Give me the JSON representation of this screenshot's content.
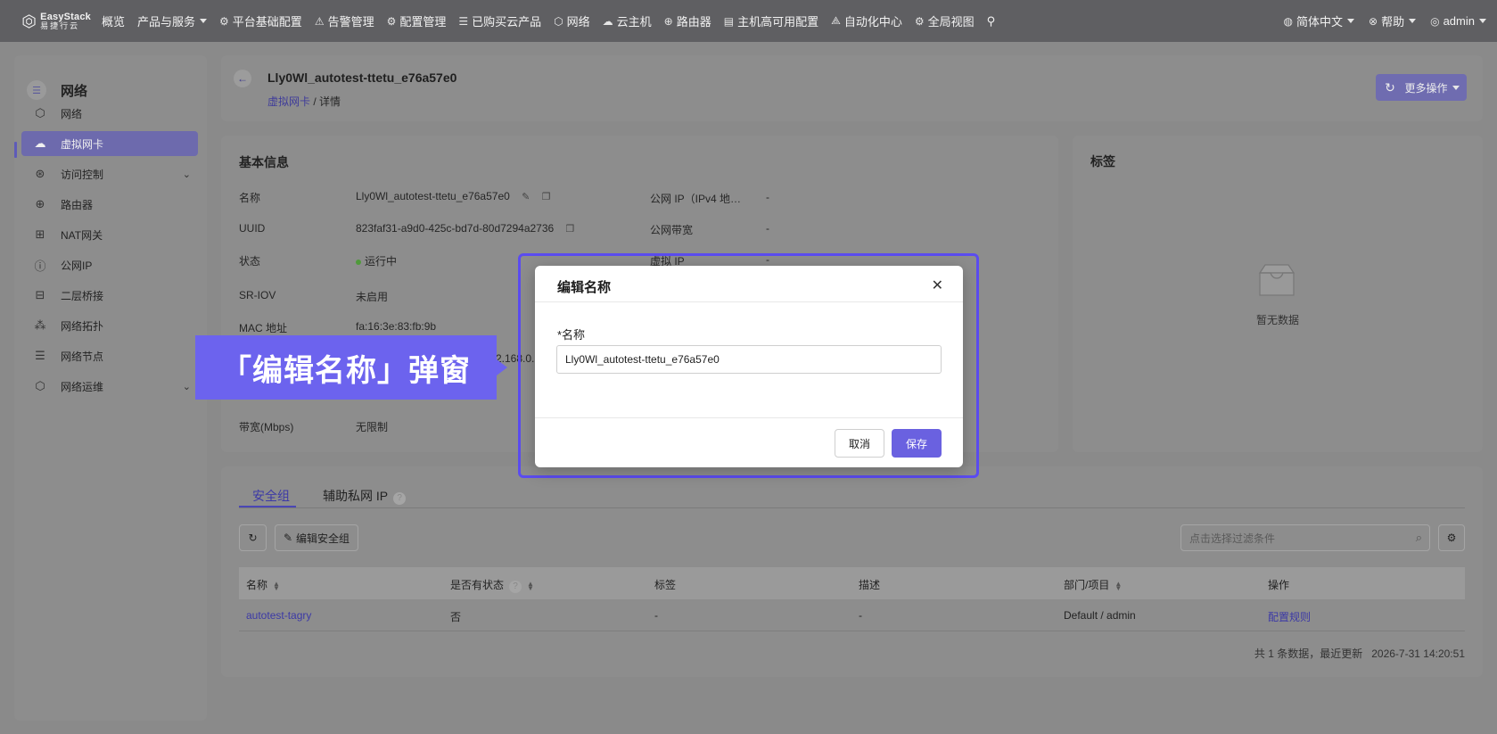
{
  "brand": {
    "name": "EasyStack",
    "subtitle": "易捷行云"
  },
  "topnav": {
    "items": [
      {
        "label": "概览",
        "icon": "",
        "caret": false
      },
      {
        "label": "产品与服务",
        "icon": "",
        "caret": true
      },
      {
        "label": "平台基础配置",
        "icon": "⚙",
        "caret": false
      },
      {
        "label": "告警管理",
        "icon": "⚠",
        "caret": false
      },
      {
        "label": "配置管理",
        "icon": "⚙",
        "caret": false
      },
      {
        "label": "已购买云产品",
        "icon": "☰",
        "caret": false
      },
      {
        "label": "网络",
        "icon": "⬡",
        "caret": false
      },
      {
        "label": "云主机",
        "icon": "☁",
        "caret": false
      },
      {
        "label": "路由器",
        "icon": "⊕",
        "caret": false
      },
      {
        "label": "主机高可用配置",
        "icon": "▤",
        "caret": false
      },
      {
        "label": "自动化中心",
        "icon": "⟁",
        "caret": false
      },
      {
        "label": "全局视图",
        "icon": "⚙",
        "caret": false
      }
    ],
    "pin_icon": "pin-icon",
    "language": "简体中文",
    "help": "帮助",
    "user": "admin"
  },
  "sidebar": {
    "title": "网络",
    "items": [
      {
        "label": "网络",
        "icon": "⬡",
        "active": false,
        "expandable": false
      },
      {
        "label": "虚拟网卡",
        "icon": "☁",
        "active": true,
        "expandable": false
      },
      {
        "label": "访问控制",
        "icon": "⊛",
        "active": false,
        "expandable": true
      },
      {
        "label": "路由器",
        "icon": "⊕",
        "active": false,
        "expandable": false
      },
      {
        "label": "NAT网关",
        "icon": "⊞",
        "active": false,
        "expandable": false
      },
      {
        "label": "公网IP",
        "icon": "ⓘ",
        "active": false,
        "expandable": false
      },
      {
        "label": "二层桥接",
        "icon": "⊟",
        "active": false,
        "expandable": false
      },
      {
        "label": "网络拓扑",
        "icon": "⁂",
        "active": false,
        "expandable": false
      },
      {
        "label": "网络节点",
        "icon": "☰",
        "active": false,
        "expandable": false
      },
      {
        "label": "网络运维",
        "icon": "⬡",
        "active": false,
        "expandable": true
      }
    ]
  },
  "header": {
    "title": "Lly0Wl_autotest-ttetu_e76a57e0",
    "breadcrumb": {
      "parent": "虚拟网卡",
      "separator": "/",
      "current": "详情"
    },
    "more_actions": "更多操作"
  },
  "basic_info": {
    "title": "基本信息",
    "left": [
      {
        "label": "名称",
        "value": "Lly0Wl_autotest-ttetu_e76a57e0"
      },
      {
        "label": "UUID",
        "value": "823faf31-a9d0-425c-bd7d-80d7294a2736"
      },
      {
        "label": "状态",
        "value": "运行中"
      },
      {
        "label": "SR-IOV",
        "value": "未启用"
      },
      {
        "label": "MAC 地址",
        "value": "fa:16:3e:83:fb:9b"
      },
      {
        "label": "带宽(Mbps)",
        "value": "无限制"
      }
    ],
    "partial_ip": "2.168.0.",
    "right": [
      {
        "label": "公网 IP（IPv4 地…",
        "value": "-"
      },
      {
        "label": "公网带宽",
        "value": "-"
      },
      {
        "label": "虚拟 IP",
        "value": "-"
      }
    ]
  },
  "tags": {
    "title": "标签",
    "empty_text": "暂无数据"
  },
  "bottom": {
    "tabs": [
      "安全组",
      "辅助私网 IP"
    ],
    "edit_sg_label": "编辑安全组",
    "search_placeholder": "点击选择过滤条件",
    "columns": [
      "名称",
      "是否有状态",
      "标签",
      "描述",
      "部门/项目",
      "操作"
    ],
    "rows": [
      {
        "name": "autotest-tagry",
        "stateful": "否",
        "tags": "-",
        "desc": "-",
        "project": "Default / admin",
        "action": "配置规则"
      }
    ],
    "footer": "共 1 条数据，最近更新",
    "updated": "2026-7-31 14:20:51"
  },
  "callout": {
    "text": "「编辑名称」弹窗"
  },
  "modal": {
    "title": "编辑名称",
    "field_label": "*名称",
    "field_value": "Lly0Wl_autotest-ttetu_e76a57e0",
    "cancel": "取消",
    "save": "保存"
  }
}
